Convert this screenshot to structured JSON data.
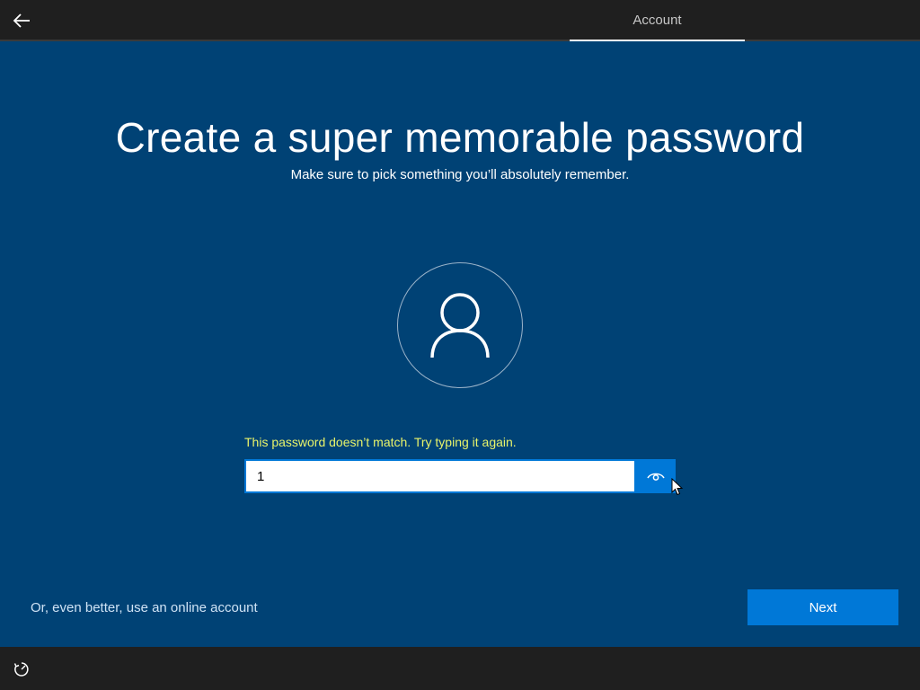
{
  "header": {
    "back_icon": "back-arrow-icon",
    "tab_label": "Account"
  },
  "main": {
    "title": "Create a super memorable password",
    "subtitle": "Make sure to pick something you’ll absolutely remember.",
    "avatar_icon": "user-icon",
    "error_message": "This password doesn’t match. Try typing it again.",
    "password_value": "1",
    "reveal_icon": "eye-icon",
    "online_account_link": "Or, even better, use an online account",
    "next_label": "Next"
  },
  "footer": {
    "ease_of_access_icon": "ease-of-access-icon"
  },
  "colors": {
    "background": "#004275",
    "bar": "#1f1f1f",
    "accent": "#0078d7",
    "error": "#e8f36a"
  }
}
